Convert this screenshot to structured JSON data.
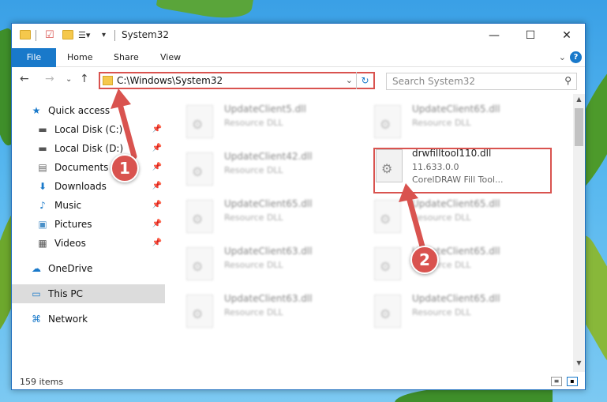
{
  "window": {
    "title": "System32",
    "minimize": "—",
    "maximize": "☐",
    "close": "✕"
  },
  "ribbon": {
    "tabs": [
      "File",
      "Home",
      "Share",
      "View"
    ],
    "help": "?"
  },
  "address": {
    "path": "C:\\Windows\\System32",
    "search_placeholder": "Search System32"
  },
  "sidebar": {
    "items": [
      {
        "label": "Quick access",
        "icon": "star-icon",
        "pinned": false
      },
      {
        "label": "Local Disk (C:)",
        "icon": "drive-icon",
        "pinned": true
      },
      {
        "label": "Local Disk (D:)",
        "icon": "drive-icon",
        "pinned": true
      },
      {
        "label": "Documents",
        "icon": "document-icon",
        "pinned": true
      },
      {
        "label": "Downloads",
        "icon": "download-icon",
        "pinned": true
      },
      {
        "label": "Music",
        "icon": "music-icon",
        "pinned": true
      },
      {
        "label": "Pictures",
        "icon": "picture-icon",
        "pinned": true
      },
      {
        "label": "Videos",
        "icon": "video-icon",
        "pinned": true
      },
      {
        "label": "OneDrive",
        "icon": "cloud-icon",
        "pinned": false
      },
      {
        "label": "This PC",
        "icon": "computer-icon",
        "pinned": false,
        "selected": true
      },
      {
        "label": "Network",
        "icon": "network-icon",
        "pinned": false
      }
    ]
  },
  "files": {
    "col1": [
      {
        "name": "UpdateClient5.dll",
        "sub": "Resource DLL"
      },
      {
        "name": "UpdateClient42.dll",
        "sub": "Resource DLL"
      },
      {
        "name": "UpdateClient65.dll",
        "sub": "Resource DLL"
      },
      {
        "name": "UpdateClient63.dll",
        "sub": "Resource DLL"
      },
      {
        "name": "UpdateClient63.dll",
        "sub": "Resource DLL"
      }
    ],
    "col2": [
      {
        "name": "UpdateClient65.dll",
        "sub": "Resource DLL"
      },
      {
        "name": "UpdateClient65.dll",
        "sub": "Resource DLL"
      },
      {
        "name": "UpdateClient65.dll",
        "sub": "Resource DLL"
      },
      {
        "name": "UpdateClient65.dll",
        "sub": "Resource DLL"
      }
    ],
    "highlighted": {
      "name": "drwfilltool110.dll",
      "version": "11.633.0.0",
      "description": "CorelDRAW Fill Tool..."
    }
  },
  "status": {
    "item_count": "159 items"
  },
  "callouts": {
    "one": "1",
    "two": "2"
  },
  "colors": {
    "accent": "#1979ca",
    "highlight": "#d9534f"
  }
}
